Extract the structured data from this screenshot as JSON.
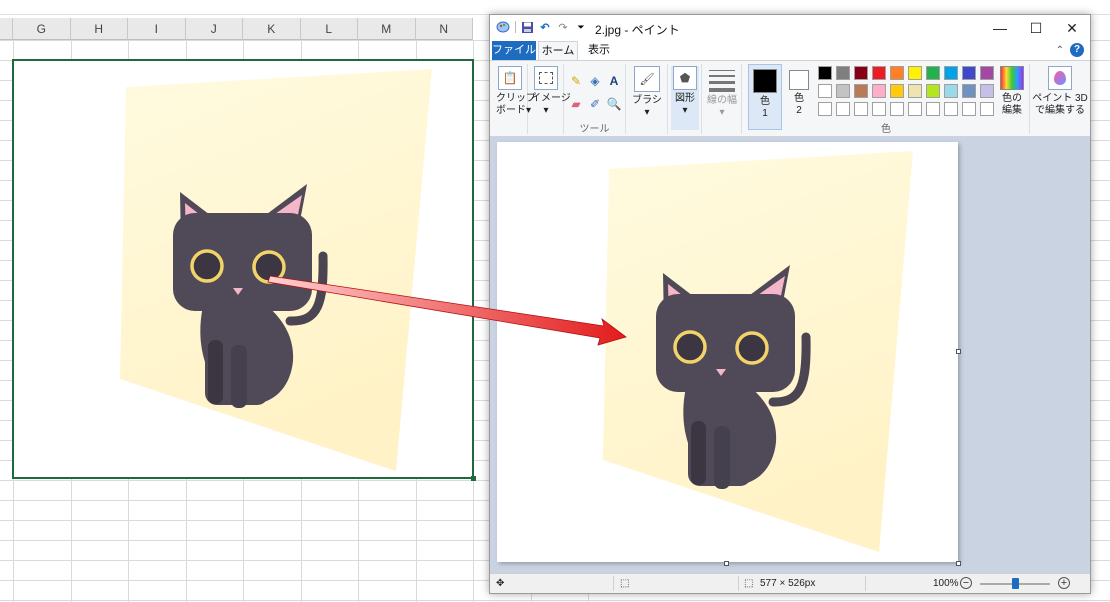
{
  "excel": {
    "columns": [
      "G",
      "H",
      "I",
      "J",
      "K",
      "L",
      "M",
      "N"
    ]
  },
  "paint": {
    "title": "2.jpg - ペイント",
    "tabs": {
      "file": "ファイル",
      "home": "ホーム",
      "view": "表示"
    },
    "help": "?",
    "ribbon": {
      "clipboard": {
        "line1": "クリップ",
        "line2": "ボード▾"
      },
      "image": {
        "line1": "イメージ",
        "line2": "▾"
      },
      "tools_label": "ツール",
      "brush": {
        "line1": "ブラシ",
        "line2": "▾"
      },
      "shapes": {
        "line1": "図形",
        "line2": "▾"
      },
      "line_width": {
        "line1": "線の幅",
        "line2": "▾"
      },
      "color1": {
        "line1": "色",
        "line2": "1"
      },
      "color2": {
        "line1": "色",
        "line2": "2"
      },
      "colors_label": "色",
      "edit_colors": {
        "line1": "色の",
        "line2": "編集"
      },
      "paint3d": {
        "line1": "ペイント 3D",
        "line2": "で編集する"
      },
      "palette_row1": [
        "#000000",
        "#7f7f7f",
        "#880015",
        "#ed1c24",
        "#ff7f27",
        "#fff200",
        "#22b14c",
        "#00a2e8",
        "#3f48cc",
        "#a349a4"
      ],
      "palette_row2": [
        "#ffffff",
        "#c3c3c3",
        "#b97a57",
        "#ffaec9",
        "#ffc90e",
        "#efe4b0",
        "#b5e61d",
        "#99d9ea",
        "#7092be",
        "#c8bfe7"
      ],
      "palette_row3": [
        "#ffffff",
        "#ffffff",
        "#ffffff",
        "#ffffff",
        "#ffffff",
        "#ffffff",
        "#ffffff",
        "#ffffff",
        "#ffffff",
        "#ffffff"
      ]
    },
    "status": {
      "image_size": "577 × 526px",
      "zoom": "100%",
      "zoom_out": "−",
      "zoom_in": "+"
    }
  },
  "colors": {
    "excel_selection": "#1d6b3a",
    "paint_accent": "#1e6cc0",
    "work_area": "#c9d3e2",
    "arrow": "#e31b1b"
  }
}
